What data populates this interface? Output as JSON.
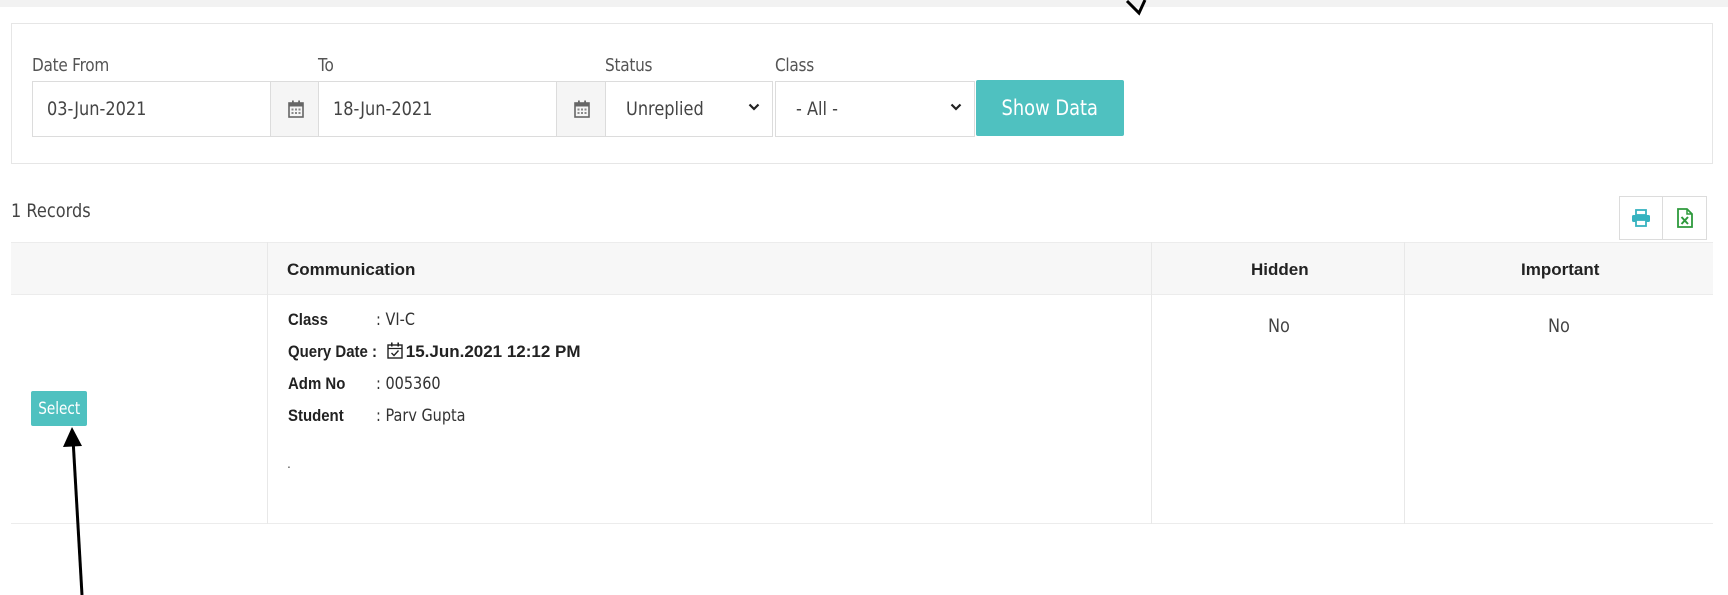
{
  "filters": {
    "date_from_label": "Date From",
    "date_from_value": "03-Jun-2021",
    "to_label": "To",
    "to_value": "18-Jun-2021",
    "status_label": "Status",
    "status_value": "Unreplied",
    "class_label": "Class",
    "class_value": "- All -",
    "show_button": "Show Data"
  },
  "records_count": "1 Records",
  "table": {
    "headers": [
      "",
      "Communication",
      "Hidden",
      "Important"
    ],
    "rows": [
      {
        "select_label": "Select",
        "class_key": "Class",
        "class_val": ": VI-C",
        "query_date_key": "Query Date :",
        "query_date_val": "15.Jun.2021 12:12 PM",
        "adm_key": "Adm No",
        "adm_val": ": 005360",
        "student_key": "Student",
        "student_val": ": Parv Gupta",
        "message": ".",
        "hidden": "No",
        "important": "No"
      }
    ]
  },
  "icons": {
    "print": "print-icon",
    "excel": "excel-icon",
    "calendar": "calendar-icon",
    "chevron": "chevron-down-icon"
  },
  "colors": {
    "accent": "#4fc1c0",
    "excel_green": "#2e9a3c",
    "print_teal": "#37b3c0"
  }
}
